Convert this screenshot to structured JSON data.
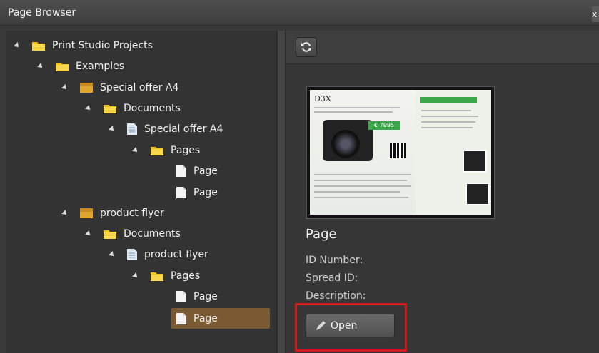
{
  "window": {
    "title": "Page Browser",
    "close_glyph": "x"
  },
  "tree": {
    "nodes": [
      {
        "label": "Print Studio Projects",
        "icon": "folder-icon"
      },
      {
        "label": "Examples",
        "icon": "folder-icon"
      },
      {
        "label": "Special offer A4",
        "icon": "project-icon"
      },
      {
        "label": "Documents",
        "icon": "folder-icon"
      },
      {
        "label": "Special offer A4",
        "icon": "document-icon"
      },
      {
        "label": "Pages",
        "icon": "folder-icon"
      },
      {
        "label": "Page",
        "icon": "page-icon"
      },
      {
        "label": "Page",
        "icon": "page-icon"
      },
      {
        "label": "product flyer",
        "icon": "project-icon"
      },
      {
        "label": "Documents",
        "icon": "folder-icon"
      },
      {
        "label": "product flyer",
        "icon": "document-icon"
      },
      {
        "label": "Pages",
        "icon": "folder-icon"
      },
      {
        "label": "Page",
        "icon": "page-icon"
      },
      {
        "label": "Page",
        "icon": "page-icon"
      }
    ],
    "selected_index": 13
  },
  "details": {
    "title": "Page",
    "id_label": "ID Number:",
    "spread_label": "Spread ID:",
    "description_label": "Description:",
    "open_label": "Open",
    "preview": {
      "heading": "D3X",
      "price": "€ 7995"
    }
  },
  "colors": {
    "accent": "#7a5a32",
    "highlight": "#d41a1a",
    "folder": "#f2c21a"
  }
}
